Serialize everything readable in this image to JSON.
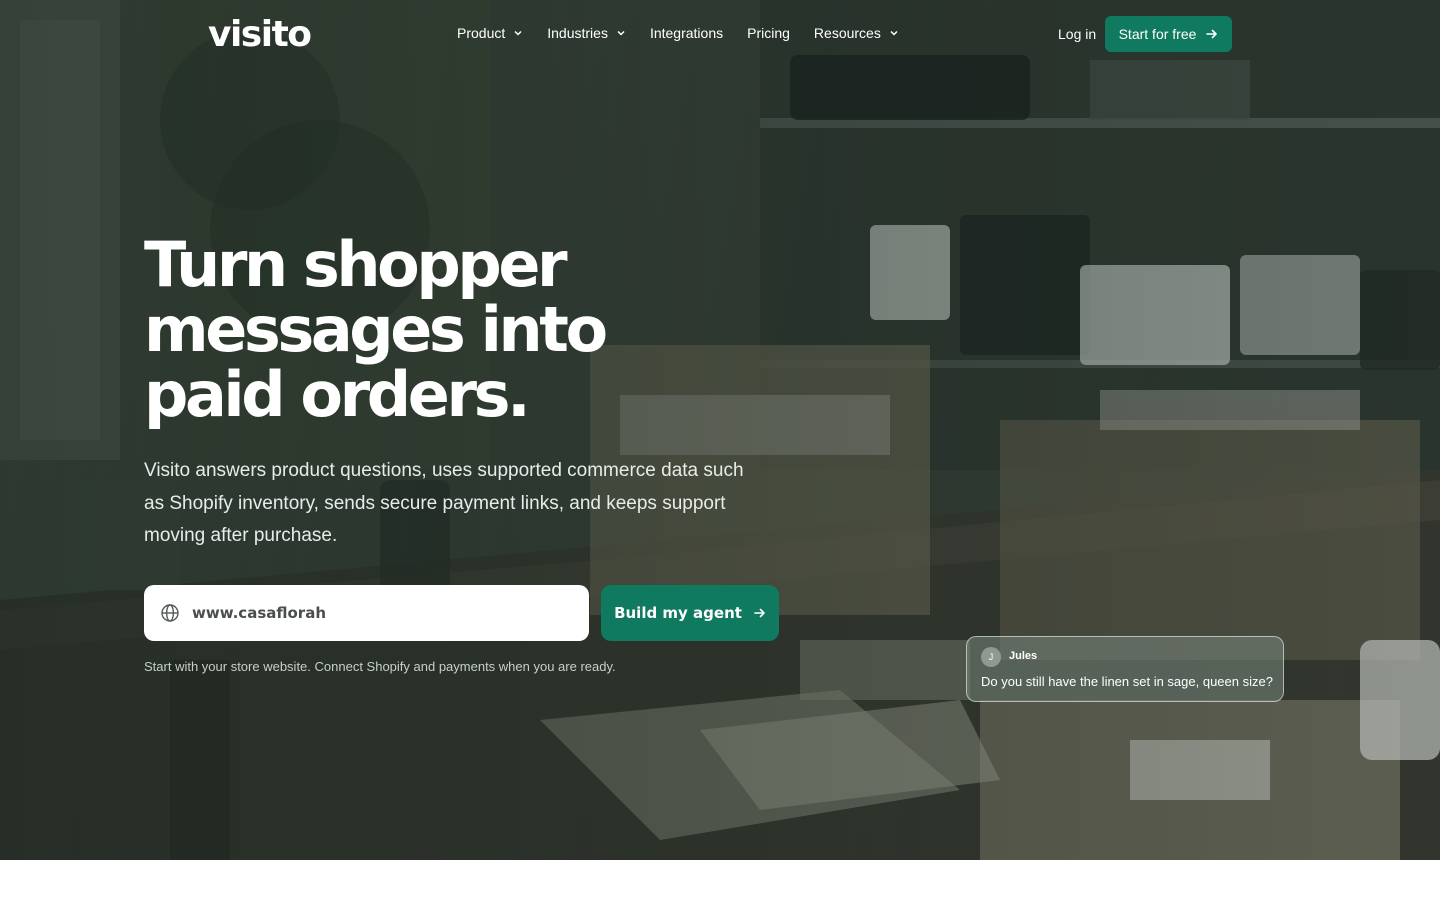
{
  "brand": {
    "logo": "visito",
    "accent": "#0f7a5f"
  },
  "nav": {
    "items": [
      {
        "label": "Product",
        "has_dropdown": true
      },
      {
        "label": "Industries",
        "has_dropdown": true
      },
      {
        "label": "Integrations",
        "has_dropdown": false
      },
      {
        "label": "Pricing",
        "has_dropdown": false
      },
      {
        "label": "Resources",
        "has_dropdown": true
      }
    ],
    "login": "Log in",
    "cta": "Start for free"
  },
  "hero": {
    "headline_lines": [
      "Turn shopper",
      "messages into",
      "paid orders."
    ],
    "subtext": "Visito answers product questions, uses supported commerce data such as Shopify inventory, sends secure payment links, and keeps support moving after purchase.",
    "url_input": {
      "value": "www.casaflorah",
      "icon": "globe-icon"
    },
    "build_button": "Build my agent",
    "hint": "Start with your store website. Connect Shopify and payments when you are ready."
  },
  "chat_preview": {
    "initial": "J",
    "name": "Jules",
    "message": "Do you still have the linen set in sage, queen size?"
  }
}
